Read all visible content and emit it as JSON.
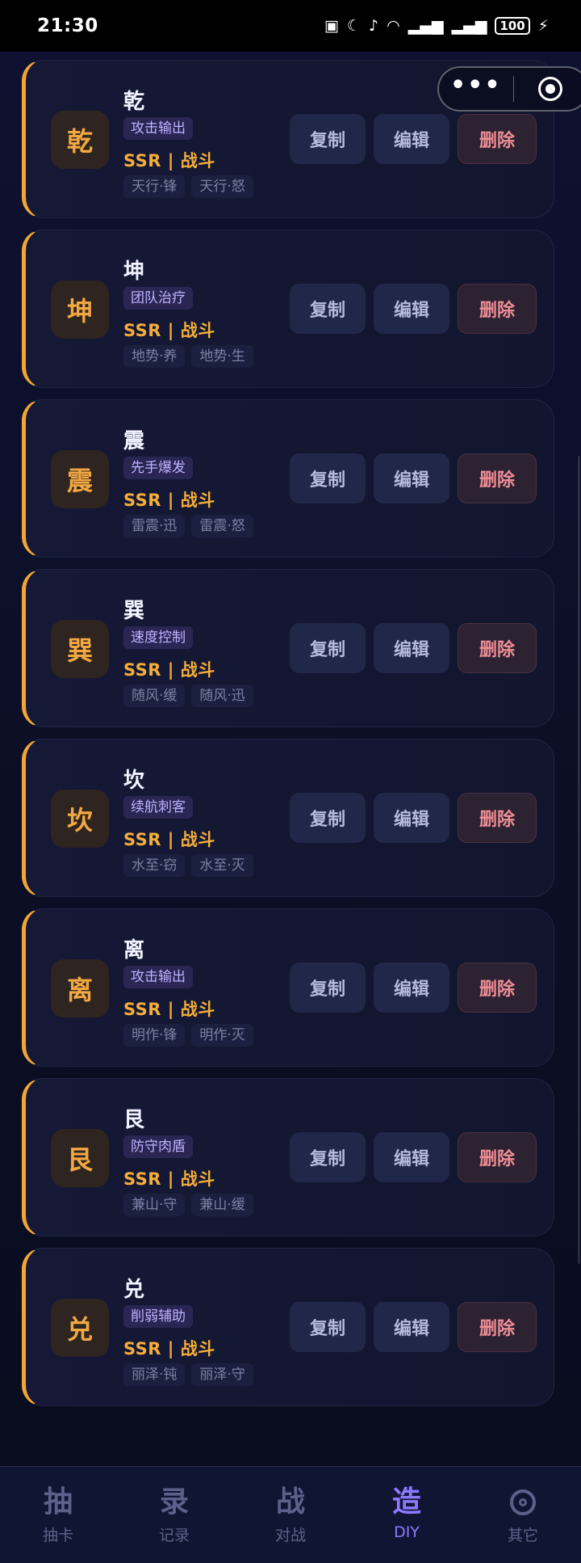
{
  "status": {
    "time": "21:30",
    "icons": [
      "nfc-icon",
      "moon-icon",
      "mute-icon",
      "wifi-icon",
      "signal-5g-icon",
      "signal-4g-icon"
    ],
    "battery": "100"
  },
  "capsule": {
    "more_icon": "more-dots-icon",
    "close_icon": "target-icon"
  },
  "buttons": {
    "copy": "复制",
    "edit": "编辑",
    "delete": "删除"
  },
  "cards": [
    {
      "avatar": "乾",
      "name": "乾",
      "role": "攻击输出",
      "rarity": "SSR | 战斗",
      "skills": [
        "天行·锋",
        "天行·怒"
      ]
    },
    {
      "avatar": "坤",
      "name": "坤",
      "role": "团队治疗",
      "rarity": "SSR | 战斗",
      "skills": [
        "地势·养",
        "地势·生"
      ]
    },
    {
      "avatar": "震",
      "name": "震",
      "role": "先手爆发",
      "rarity": "SSR | 战斗",
      "skills": [
        "雷震·迅",
        "雷震·怒"
      ]
    },
    {
      "avatar": "巽",
      "name": "巽",
      "role": "速度控制",
      "rarity": "SSR | 战斗",
      "skills": [
        "随风·缓",
        "随风·迅"
      ]
    },
    {
      "avatar": "坎",
      "name": "坎",
      "role": "续航刺客",
      "rarity": "SSR | 战斗",
      "skills": [
        "水至·窃",
        "水至·灭"
      ]
    },
    {
      "avatar": "离",
      "name": "离",
      "role": "攻击输出",
      "rarity": "SSR | 战斗",
      "skills": [
        "明作·锋",
        "明作·灭"
      ]
    },
    {
      "avatar": "艮",
      "name": "艮",
      "role": "防守肉盾",
      "rarity": "SSR | 战斗",
      "skills": [
        "兼山·守",
        "兼山·缓"
      ]
    },
    {
      "avatar": "兑",
      "name": "兑",
      "role": "削弱辅助",
      "rarity": "SSR | 战斗",
      "skills": [
        "丽泽·钝",
        "丽泽·守"
      ]
    }
  ],
  "tabs": [
    {
      "glyph": "抽",
      "label": "抽卡",
      "active": false
    },
    {
      "glyph": "录",
      "label": "记录",
      "active": false
    },
    {
      "glyph": "战",
      "label": "对战",
      "active": false
    },
    {
      "glyph": "造",
      "label": "DIY",
      "active": true
    },
    {
      "glyph": "",
      "label": "其它",
      "active": false,
      "icon": "gear-icon"
    }
  ],
  "colors": {
    "accent": "#f3a633",
    "active_tab": "#8b79ff",
    "delete": "#f08e96",
    "background": "#0b0e22"
  }
}
